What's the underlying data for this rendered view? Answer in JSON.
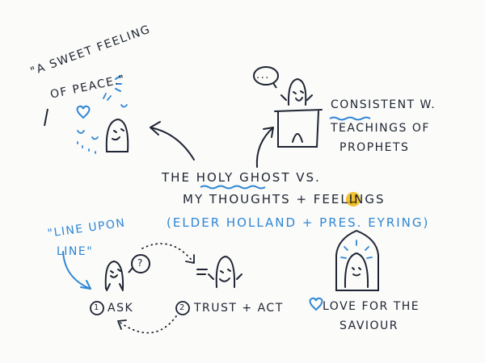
{
  "quote_peace": {
    "line1": "\"A SWEET FEELING",
    "line2": "OF PEACE.\""
  },
  "prophet": {
    "speech": "...",
    "line1": "CONSISTENT W.",
    "line2": "TEACHINGS OF",
    "line3": "PROPHETS"
  },
  "center": {
    "line1_pre": "THE",
    "line1_highlight": "HOLY GHOST",
    "line1_post": "VS.",
    "line2": "MY THOUGHTS + FEELINGS",
    "line3": "(ELDER HOLLAND + PRES. EYRING)"
  },
  "line_upon_line": {
    "line1": "\"LINE UPON",
    "line2": "LINE\""
  },
  "steps": [
    {
      "number": "1",
      "label": "ASK",
      "bubble": "?"
    },
    {
      "number": "2",
      "label": "TRUST + ACT"
    }
  ],
  "saviour": {
    "line1": "LOVE FOR THE",
    "line2": "SAVIOUR"
  },
  "colors": {
    "ink": "#1e2433",
    "accent": "#2f86d6",
    "emoji": "#f2c230"
  }
}
